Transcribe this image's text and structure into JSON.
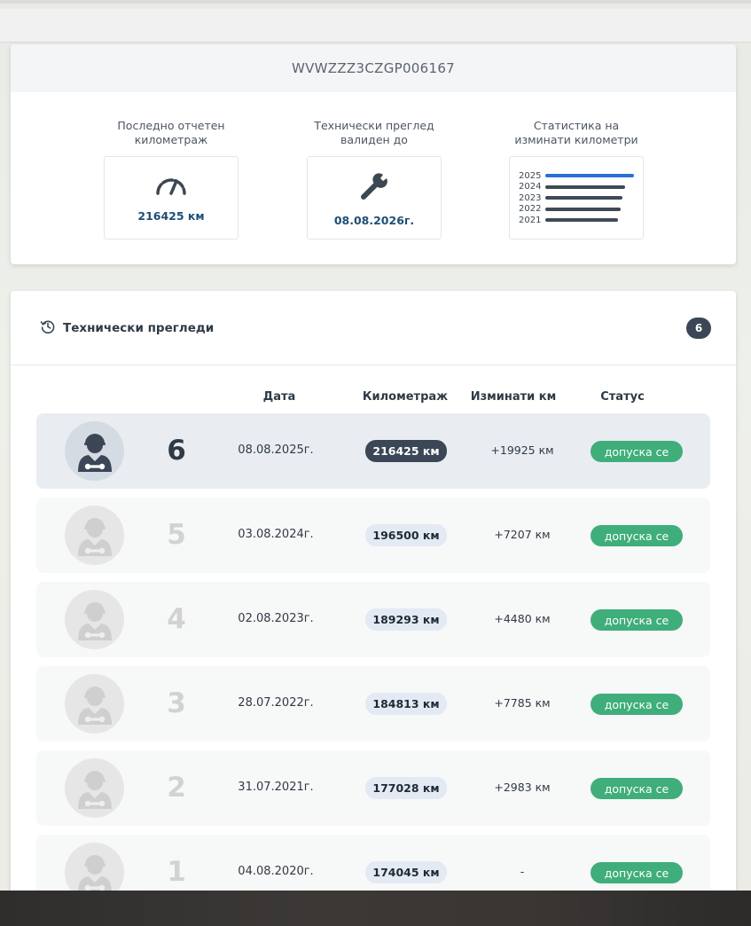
{
  "vehicle": {
    "vin": "WVWZZZ3CZGP006167"
  },
  "stats": {
    "mileage_label": "Последно отчетен километраж",
    "mileage_value": "216425 км",
    "inspection_label": "Технически преглед валиден до",
    "inspection_value": "08.08.2026г.",
    "statistics_label": "Статистика на изминати километри",
    "years": [
      "2025",
      "2024",
      "2023",
      "2022",
      "2021"
    ],
    "year_bar_fractions": [
      1.0,
      0.9,
      0.87,
      0.85,
      0.82
    ],
    "year_bar_colors": [
      "#2a6fd6",
      "#404a56",
      "#404a56",
      "#404a56",
      "#404a56"
    ]
  },
  "inspections": {
    "title": "Технически прегледи",
    "count": "6",
    "columns": {
      "date": "Дата",
      "mileage": "Километраж",
      "traveled": "Изминати км",
      "status": "Статус"
    },
    "rows": [
      {
        "number": "6",
        "date": "08.08.2025г.",
        "mileage": "216425 км",
        "traveled": "+19925 км",
        "status": "допуска се",
        "active": true
      },
      {
        "number": "5",
        "date": "03.08.2024г.",
        "mileage": "196500 км",
        "traveled": "+7207 км",
        "status": "допуска се",
        "active": false
      },
      {
        "number": "4",
        "date": "02.08.2023г.",
        "mileage": "189293 км",
        "traveled": "+4480 км",
        "status": "допуска се",
        "active": false
      },
      {
        "number": "3",
        "date": "28.07.2022г.",
        "mileage": "184813 км",
        "traveled": "+7785 км",
        "status": "допуска се",
        "active": false
      },
      {
        "number": "2",
        "date": "31.07.2021г.",
        "mileage": "177028 км",
        "traveled": "+2983 км",
        "status": "допуска се",
        "active": false
      },
      {
        "number": "1",
        "date": "04.08.2020г.",
        "mileage": "174045 км",
        "traveled": "-",
        "status": "допуска се",
        "active": false
      }
    ]
  },
  "colors": {
    "status_green": "#3fae7a",
    "accent_dark": "#3b4756",
    "accent_blue": "#1f4f74"
  }
}
